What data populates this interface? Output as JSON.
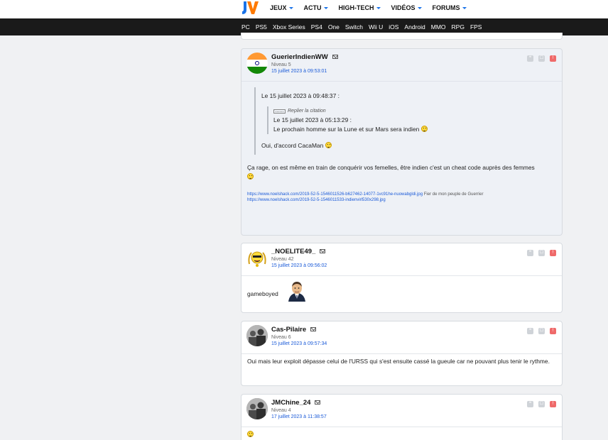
{
  "header": {
    "logo": "JV",
    "nav": [
      "JEUX",
      "ACTU",
      "HIGH-TECH",
      "VIDÉOS",
      "FORUMS"
    ],
    "platforms": [
      "PC",
      "PS5",
      "Xbox Series",
      "PS4",
      "One",
      "Switch",
      "Wii U",
      "iOS",
      "Android",
      "MMO",
      "RPG",
      "FPS"
    ]
  },
  "colors": {
    "accent": "#1a5ad8",
    "nav_bar": "#1a1a1a",
    "alert": "#ef6a6a"
  },
  "posts": [
    {
      "author": "GuerierIndienWW",
      "level": "Niveau 5",
      "date": "15 juillet 2023 à 09:53:01",
      "avatar": "india-flag",
      "quote_title": "Le 15 juillet 2023 à 09:48:37 :",
      "nested_quote_label": "Replier la citation",
      "nested_quote_title": "Le 15 juillet 2023 à 05:13:29 :",
      "nested_quote_text": "Le prochain homme sur la Lune et sur Mars sera indien",
      "quote_text": "Oui, d'accord CacaMan",
      "text": "Ça rage, on est même en train de conquérir vos femelles, être indien c'est un cheat code auprès des femmes",
      "sig_link1": "https://www.noelshack.com/2019-52-5-1546011526-b627462-14077-1vc91he-nuowabgldi.jpg",
      "sig_text1": "Fier de mon peuple de Guerrier",
      "sig_link2": "https://www.noelshack.com/2019-52-5-1546011533-indienvirl530x298.jpg"
    },
    {
      "author": "_NOELITE49_",
      "level": "Niveau 42",
      "date": "15 juillet 2023 à 09:56:02",
      "avatar": "noelite-smiley",
      "text": "gameboyed"
    },
    {
      "author": "Cas-Pilaire",
      "level": "Niveau 6",
      "date": "15 juillet 2023 à 09:57:34",
      "avatar": "group-photo",
      "text": "Oui mais leur exploit dépasse celui de l'URSS qui s'est ensuite cassé la gueule car ne pouvant plus tenir le rythme."
    },
    {
      "author": "JMChine_24",
      "level": "Niveau 4",
      "date": "17 juillet 2023 à 11:38:57",
      "avatar": "group-photo"
    }
  ]
}
